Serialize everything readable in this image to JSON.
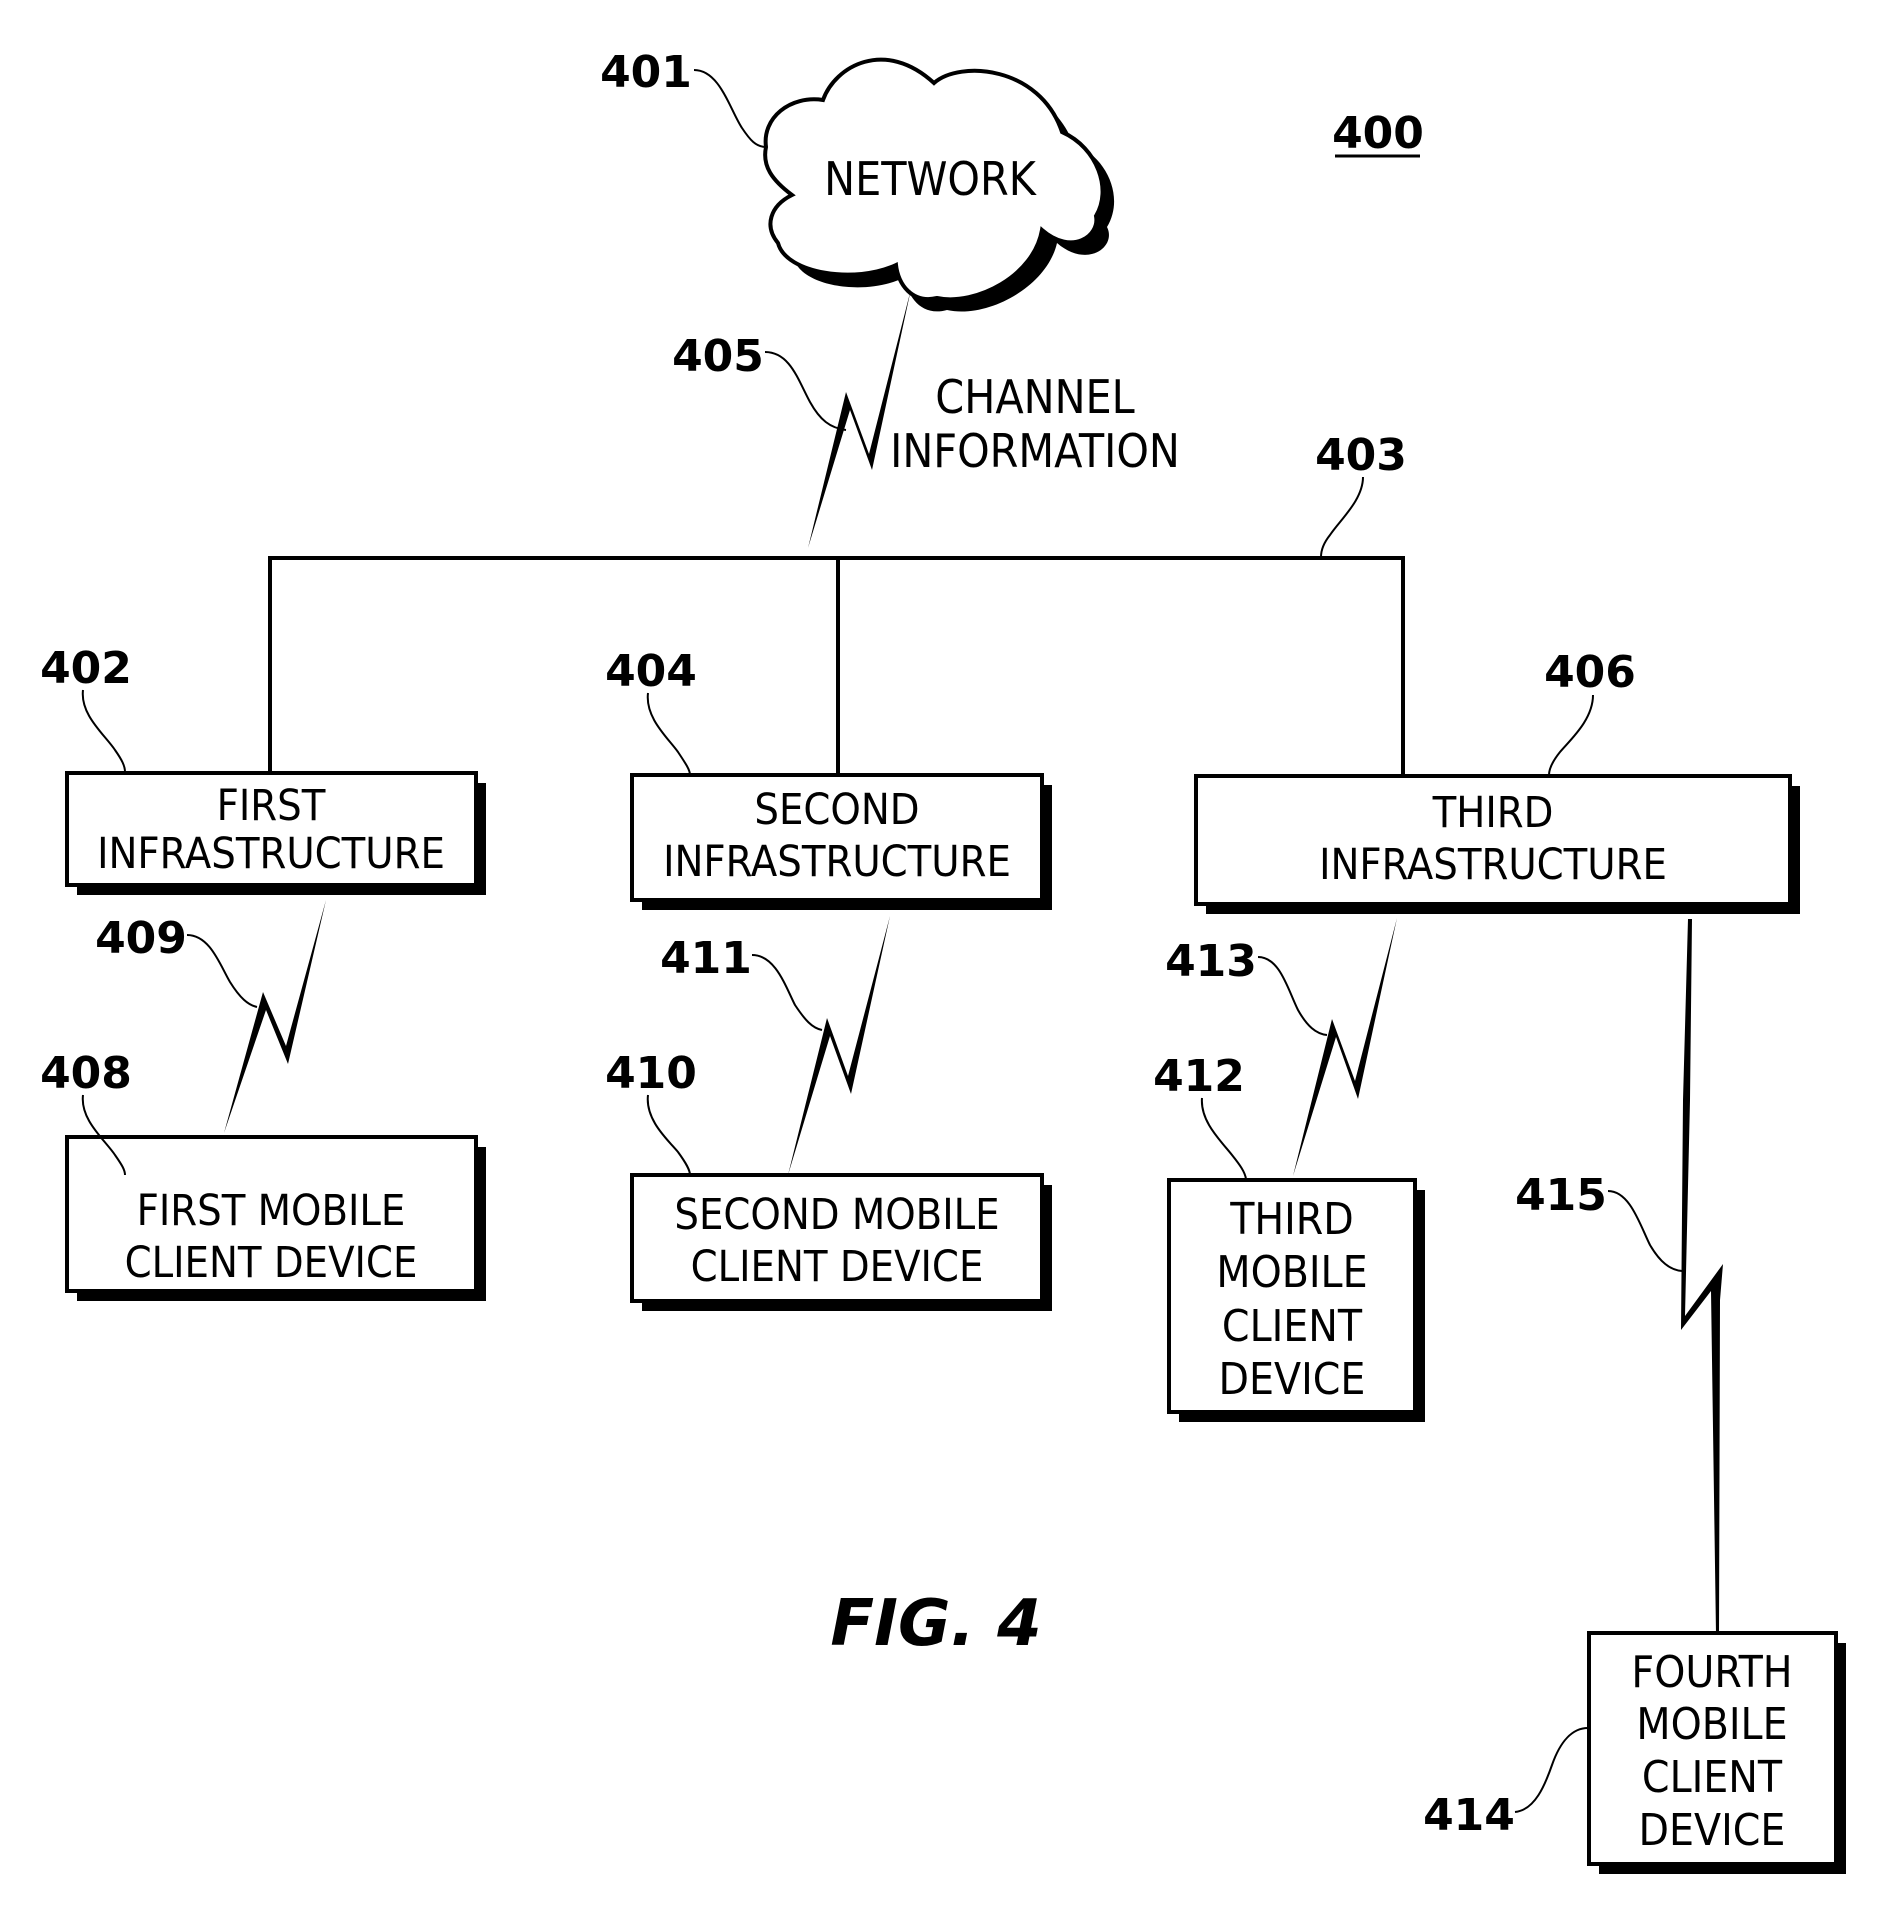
{
  "figure": {
    "number_label": "400",
    "caption": "FIG. 4"
  },
  "network": {
    "ref": "401",
    "label": "NETWORK"
  },
  "channel": {
    "ref": "405",
    "label_lines": [
      "CHANNEL",
      "INFORMATION"
    ]
  },
  "bus": {
    "ref": "403"
  },
  "infrastructures": [
    {
      "ref": "402",
      "label_lines": [
        "FIRST",
        "INFRASTRUCTURE"
      ]
    },
    {
      "ref": "404",
      "label_lines": [
        "SECOND",
        "INFRASTRUCTURE"
      ]
    },
    {
      "ref": "406",
      "label_lines": [
        "THIRD",
        "INFRASTRUCTURE"
      ]
    }
  ],
  "links": [
    {
      "ref": "409"
    },
    {
      "ref": "411"
    },
    {
      "ref": "413"
    },
    {
      "ref": "415"
    }
  ],
  "mobile_devices": [
    {
      "ref": "408",
      "label_lines": [
        "FIRST MOBILE",
        "CLIENT DEVICE"
      ]
    },
    {
      "ref": "410",
      "label_lines": [
        "SECOND MOBILE",
        "CLIENT DEVICE"
      ]
    },
    {
      "ref": "412",
      "label_lines": [
        "THIRD",
        "MOBILE",
        "CLIENT",
        "DEVICE"
      ]
    },
    {
      "ref": "414",
      "label_lines": [
        "FOURTH",
        "MOBILE",
        "CLIENT",
        "DEVICE"
      ]
    }
  ]
}
